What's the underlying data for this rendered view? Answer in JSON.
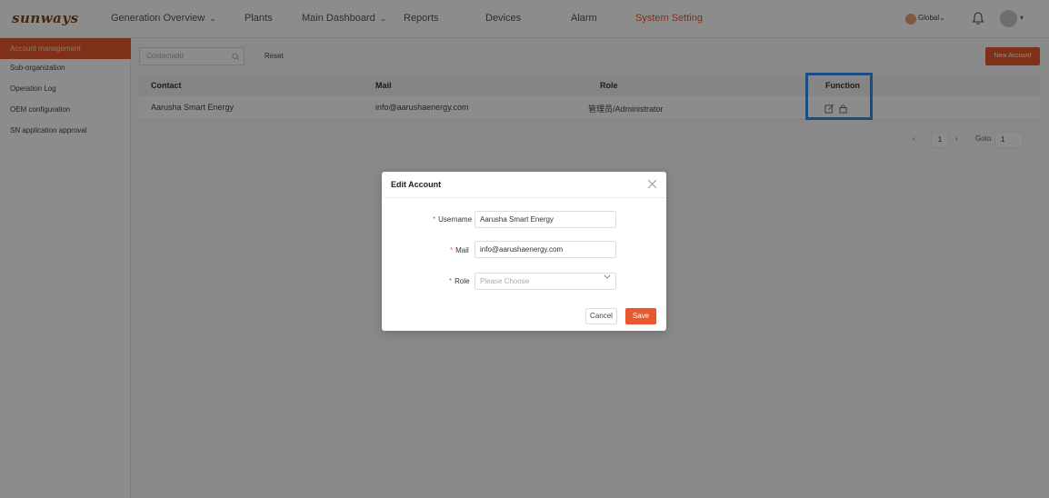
{
  "brand": {
    "logo_text": "sunways"
  },
  "nav": {
    "items": [
      {
        "label": "Generation Overview",
        "dropdown": true
      },
      {
        "label": "Plants",
        "dropdown": false
      },
      {
        "label": "Main Dashboard",
        "dropdown": true
      },
      {
        "label": "Reports",
        "dropdown": false
      },
      {
        "label": "Devices",
        "dropdown": false
      },
      {
        "label": "Alarm",
        "dropdown": false
      },
      {
        "label": "System Setting",
        "dropdown": false,
        "active": true
      }
    ],
    "language_label": "Global",
    "chevron": "⌄",
    "caret": "▾"
  },
  "sidebar": {
    "items": [
      {
        "label": "Account management",
        "active": true
      },
      {
        "label": "Sub-organization"
      },
      {
        "label": "Operation Log"
      },
      {
        "label": "OEM configuration"
      },
      {
        "label": "SN application approval"
      }
    ]
  },
  "toolbar": {
    "search_placeholder": "Contactadd",
    "reset_label": "Reset",
    "new_account_label": "New Account"
  },
  "table": {
    "columns": [
      "Contact",
      "Mail",
      "Role",
      "Function"
    ],
    "rows": [
      {
        "contact": "Aarusha Smart Energy",
        "mail": "info@aarushaenergy.com",
        "role": "管理员/Administrator"
      }
    ]
  },
  "pagination": {
    "prev": "‹",
    "next": "›",
    "current_page": "1",
    "goto_label": "Goto",
    "goto_value": "1"
  },
  "modal": {
    "title": "Edit Account",
    "required_mark": "*",
    "fields": {
      "username": {
        "label": "Username",
        "value": "Aarusha Smart Energy"
      },
      "mail": {
        "label": "Mail",
        "value": "info@aarushaenergy.com"
      },
      "role": {
        "label": "Role",
        "placeholder": "Please Choose"
      }
    },
    "cancel_label": "Cancel",
    "save_label": "Save"
  },
  "colors": {
    "accent": "#e8582e",
    "highlight": "#2d8ff0"
  },
  "icons": {
    "search": "search-icon",
    "bell": "bell-icon",
    "edit": "edit-icon",
    "lock": "lock-icon",
    "close": "close-icon"
  }
}
